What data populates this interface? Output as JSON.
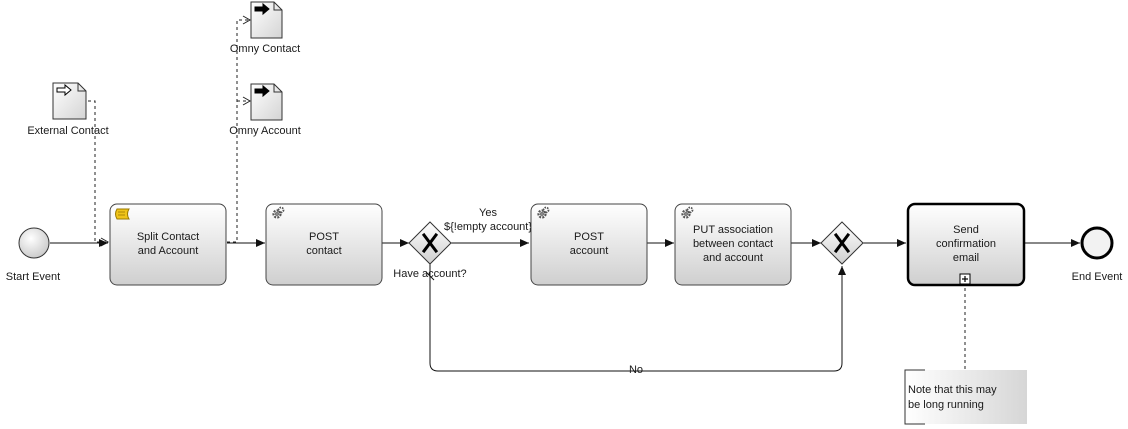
{
  "diagram": {
    "start_event": {
      "label": "Start Event"
    },
    "end_event": {
      "label": "End Event"
    },
    "data_objects": {
      "external_contact": {
        "label": "External Contact"
      },
      "omny_contact": {
        "label": "Omny Contact"
      },
      "omny_account": {
        "label": "Omny Account"
      }
    },
    "tasks": {
      "split": {
        "line1": "Split Contact",
        "line2": "and Account",
        "icon": "script-icon"
      },
      "post_contact": {
        "line1": "POST",
        "line2": "contact",
        "icon": "gear-icon"
      },
      "post_account": {
        "line1": "POST",
        "line2": "account",
        "icon": "gear-icon"
      },
      "put_assoc": {
        "line1": "PUT association",
        "line2": "between contact",
        "line3": "and account",
        "icon": "gear-icon"
      },
      "send_email": {
        "line1": "Send",
        "line2": "confirmation",
        "line3": "email",
        "icon": "expand-marker-icon"
      }
    },
    "gateways": {
      "have_account": {
        "label": "Have account?",
        "type": "exclusive"
      },
      "merge": {
        "type": "exclusive"
      }
    },
    "flows": {
      "yes_label": "Yes",
      "yes_condition": "${!empty account}",
      "no_label": "No"
    },
    "annotation": {
      "line1": "Note that this may",
      "line2": "be long running"
    }
  }
}
